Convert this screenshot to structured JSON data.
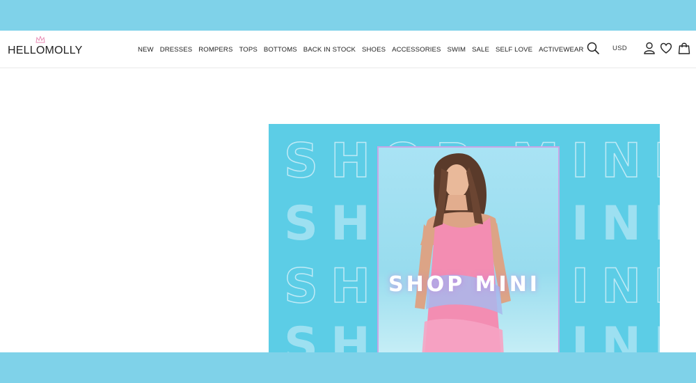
{
  "brand": {
    "logo_text": "HELLOMOLLY"
  },
  "nav": {
    "items": [
      {
        "label": "NEW"
      },
      {
        "label": "DRESSES"
      },
      {
        "label": "ROMPERS"
      },
      {
        "label": "TOPS"
      },
      {
        "label": "BOTTOMS"
      },
      {
        "label": "BACK IN STOCK"
      },
      {
        "label": "SHOES"
      },
      {
        "label": "ACCESSORIES"
      },
      {
        "label": "SWIM"
      },
      {
        "label": "SALE"
      },
      {
        "label": "SELF LOVE"
      },
      {
        "label": "ACTIVEWEAR"
      }
    ]
  },
  "header_actions": {
    "search_icon": "search-icon",
    "currency": "USD",
    "account_icon": "user-icon",
    "wishlist_icon": "heart-icon",
    "bag_icon": "shopping-bag-icon"
  },
  "hero": {
    "title": "SHOP MINI",
    "background_word": "SHOP MINI",
    "colors": {
      "banner": "#5ccde6",
      "band": "#7fd2e9",
      "frame": "#c8a6e6"
    }
  }
}
